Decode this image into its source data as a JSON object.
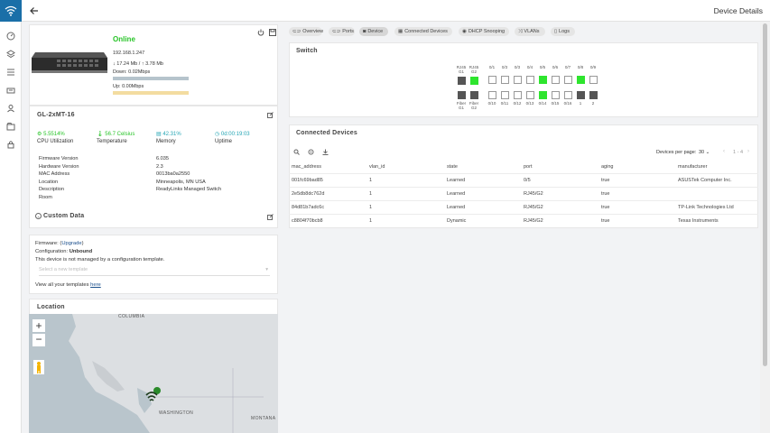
{
  "page": {
    "title": "Device Details"
  },
  "sidebar": {
    "icons": [
      "wifi-logo-icon",
      "dashboard-icon",
      "layers-icon",
      "list-icon",
      "router-icon",
      "user-icon",
      "folder-icon",
      "lock-icon"
    ]
  },
  "device": {
    "status": "Online",
    "ip": "192.168.1.247",
    "down_rate": "17.24 Mb /",
    "up_rate": "3.78 Mb",
    "down_label": "Down: 0.02Mbps",
    "up_label": "Up: 0.00Mbps",
    "name": "GL-2xMT-16",
    "stats": [
      {
        "value": "5.5514%",
        "label": "CPU Utilization"
      },
      {
        "value": "56.7 Celsius",
        "label": "Temperature"
      },
      {
        "value": "42.31%",
        "label": "Memory"
      },
      {
        "value": "0d:00:19:03",
        "label": "Uptime"
      }
    ],
    "info": [
      {
        "k": "Firmware Version",
        "v": "6.035"
      },
      {
        "k": "Hardware Version",
        "v": "2.3"
      },
      {
        "k": "MAC Address",
        "v": "0013ba0a2550"
      },
      {
        "k": "Location",
        "v": "Minneapolis, MN USA"
      },
      {
        "k": "Description",
        "v": "ReadyLinks Managed Switch"
      },
      {
        "k": "Room",
        "v": ""
      }
    ],
    "custom_data_title": "Custom Data"
  },
  "firmware": {
    "label": "Firmware: (",
    "link": "Upgrade",
    "close": ")",
    "config_label": "Configuration: ",
    "config_value": "Unbound",
    "note": "This device is not managed by a configuration template.",
    "select_placeholder": "Select a new template",
    "templates_text": "View all your templates ",
    "templates_link": "here"
  },
  "location": {
    "title": "Location",
    "labels": {
      "columbia": "COLUMBIA",
      "washington": "WASHINGTON",
      "montana": "MONTANA"
    }
  },
  "tabs": [
    {
      "label": "Overview",
      "icon": "link-icon"
    },
    {
      "label": "Ports",
      "icon": "link-icon"
    },
    {
      "label": "Device",
      "icon": "device-icon"
    },
    {
      "label": "Connected Devices",
      "icon": "grid-icon"
    },
    {
      "label": "DHCP Snooping",
      "icon": "eye-icon"
    },
    {
      "label": "VLANs",
      "icon": "shuffle-icon"
    },
    {
      "label": "Logs",
      "icon": "file-icon"
    }
  ],
  "switch": {
    "title": "Switch",
    "top_labels": [
      "RJ45 G1",
      "RJ45 G2",
      "0/1",
      "0/3",
      "0/3",
      "0/4",
      "0/5",
      "0/6",
      "0/7",
      "0/8",
      "0/9"
    ],
    "bottom_labels": [
      "Fiber G1",
      "Fiber G2",
      "0/10",
      "0/11",
      "0/12",
      "0/13",
      "0/14",
      "0/15",
      "0/16",
      "1",
      "2"
    ],
    "top_states": [
      "dk",
      "up",
      "off",
      "off",
      "off",
      "off",
      "up",
      "off",
      "off",
      "up",
      "off"
    ],
    "bottom_states": [
      "dk",
      "dk",
      "off",
      "off",
      "off",
      "off",
      "up",
      "off",
      "off",
      "dk",
      "dk"
    ]
  },
  "connected": {
    "title": "Connected Devices",
    "per_page_label": "Devices per page:",
    "per_page": "30",
    "range": "1 - 4",
    "columns": [
      "mac_address",
      "vlan_id",
      "state",
      "port",
      "aging",
      "manufacturer"
    ],
    "rows": [
      [
        "001fc69bad85",
        "1",
        "Learned",
        "0/5",
        "true",
        "ASUSTek Computer Inc."
      ],
      [
        "2e5db8dc762d",
        "1",
        "Learned",
        "RJ45/G2",
        "true",
        ""
      ],
      [
        "84d81b7adc6c",
        "1",
        "Learned",
        "RJ45/G2",
        "true",
        "TP-Link Technologies Ltd"
      ],
      [
        "c8804f70bcb8",
        "1",
        "Dynamic",
        "RJ45/G2",
        "true",
        "Texas Instruments"
      ]
    ]
  }
}
